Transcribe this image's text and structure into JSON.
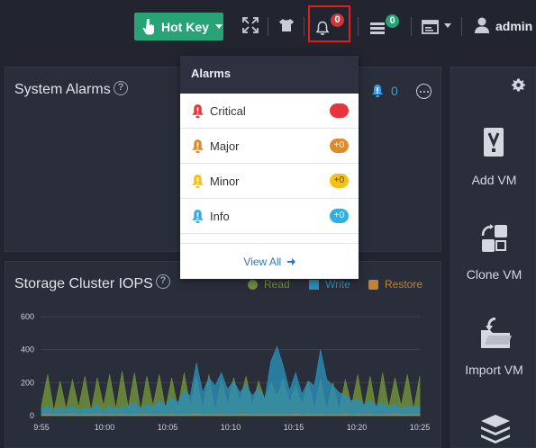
{
  "topbar": {
    "hotkey_label": "Hot Key",
    "bell_badge": "0",
    "tasks_badge": "0",
    "user_name": "admin"
  },
  "system_alarms": {
    "title": "System Alarms",
    "help": "?",
    "info_count": "0"
  },
  "storage_iops": {
    "title": "Storage Cluster IOPS",
    "help": "?",
    "legend": [
      {
        "name": "Read",
        "color": "#6f8e3a"
      },
      {
        "name": "Write",
        "color": "#2a8fb8"
      },
      {
        "name": "Restore",
        "color": "#c28233"
      }
    ]
  },
  "chart_data": {
    "type": "area",
    "title": "Storage Cluster IOPS",
    "ylim": [
      0,
      600
    ],
    "y_ticks": [
      "600",
      "400",
      "200",
      "0"
    ],
    "x_ticks": [
      "9:55",
      "10:00",
      "10:05",
      "10:10",
      "10:15",
      "10:20",
      "10:25"
    ],
    "series": [
      {
        "name": "Read",
        "color": "#6f8e3a",
        "values": [
          60,
          250,
          30,
          210,
          40,
          220,
          50,
          240,
          30,
          230,
          60,
          250,
          40,
          270,
          50,
          260,
          30,
          240,
          60,
          250,
          40,
          230,
          50,
          260,
          60,
          240,
          40,
          250,
          30,
          220,
          70,
          230,
          90,
          240,
          60,
          210,
          100,
          200,
          120,
          230,
          80,
          190,
          60,
          210,
          50,
          220,
          40,
          200,
          30,
          220,
          60,
          250,
          40,
          240,
          30,
          260,
          50,
          230,
          60,
          250,
          40,
          240
        ]
      },
      {
        "name": "Write",
        "color": "#2a8fb8",
        "values": [
          40,
          60,
          30,
          50,
          40,
          60,
          30,
          50,
          40,
          70,
          30,
          60,
          40,
          50,
          60,
          80,
          40,
          70,
          50,
          90,
          60,
          110,
          80,
          150,
          120,
          320,
          140,
          230,
          180,
          260,
          160,
          210,
          140,
          190,
          120,
          170,
          100,
          330,
          420,
          300,
          150,
          260,
          130,
          210,
          180,
          400,
          220,
          180,
          140,
          120,
          90,
          100,
          70,
          90,
          60,
          80,
          50,
          70,
          40,
          60,
          50,
          60
        ]
      },
      {
        "name": "Restore",
        "color": "#c28233",
        "values": [
          5,
          8,
          4,
          6,
          5,
          7,
          4,
          6,
          5,
          8,
          4,
          6,
          5,
          7,
          4,
          6,
          5,
          8,
          4,
          6,
          5,
          7,
          4,
          6,
          5,
          8,
          4,
          6,
          5,
          7,
          4,
          6,
          5,
          8,
          4,
          6,
          5,
          7,
          4,
          6,
          5,
          8,
          4,
          6,
          5,
          7,
          4,
          6,
          5,
          8,
          4,
          6,
          5,
          7,
          4,
          6,
          5,
          8,
          4,
          6,
          5,
          7
        ]
      }
    ]
  },
  "actions": [
    {
      "label": "Add VM"
    },
    {
      "label": "Clone VM"
    },
    {
      "label": "Import VM"
    }
  ],
  "alarms_menu": {
    "title": "Alarms",
    "rows": [
      {
        "label": "Critical",
        "count": "+0",
        "color": "#e8353b"
      },
      {
        "label": "Major",
        "count": "+0",
        "color": "#de8a2e"
      },
      {
        "label": "Minor",
        "count": "+0",
        "color": "#f2c21a"
      },
      {
        "label": "Info",
        "count": "+0",
        "color": "#33aee0"
      }
    ],
    "view_all": "View All"
  }
}
